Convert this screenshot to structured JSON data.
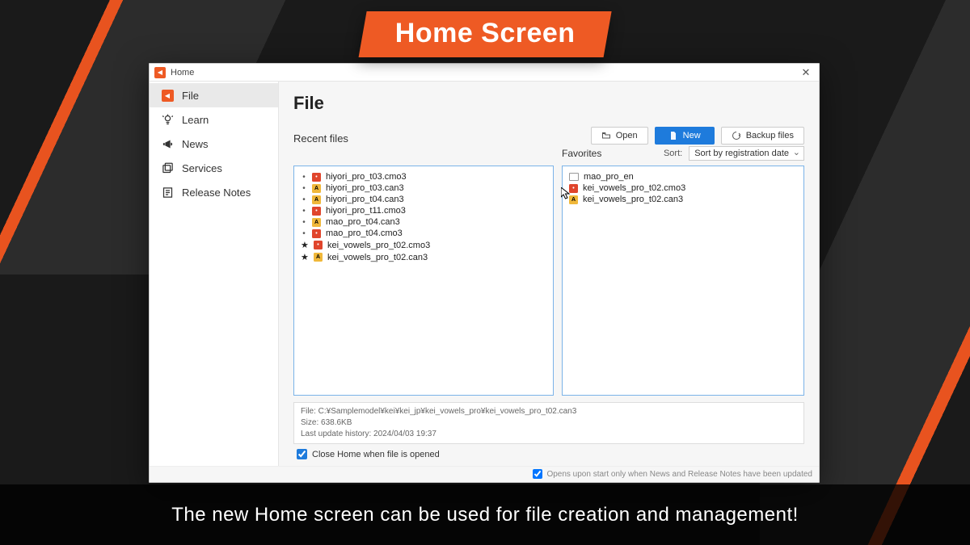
{
  "banner": {
    "title": "Home Screen"
  },
  "caption": "The new Home screen can be used for file creation and management!",
  "window": {
    "title": "Home",
    "sidebar": {
      "items": [
        {
          "label": "File",
          "icon": "file-icon",
          "active": true
        },
        {
          "label": "Learn",
          "icon": "lightbulb-icon",
          "active": false
        },
        {
          "label": "News",
          "icon": "megaphone-icon",
          "active": false
        },
        {
          "label": "Services",
          "icon": "services-icon",
          "active": false
        },
        {
          "label": "Release Notes",
          "icon": "notes-icon",
          "active": false
        }
      ]
    },
    "main": {
      "heading": "File",
      "buttons": {
        "open": "Open",
        "new": "New",
        "backup": "Backup files"
      },
      "recent_title": "Recent files",
      "favorites_title": "Favorites",
      "sort_label": "Sort:",
      "sort_value": "Sort by registration date",
      "recent_files": [
        {
          "mark": "dot",
          "type": "red",
          "name": "hiyori_pro_t03.cmo3"
        },
        {
          "mark": "dot",
          "type": "yellow",
          "name": "hiyori_pro_t03.can3"
        },
        {
          "mark": "dot",
          "type": "yellow",
          "name": "hiyori_pro_t04.can3"
        },
        {
          "mark": "dot",
          "type": "red",
          "name": "hiyori_pro_t11.cmo3"
        },
        {
          "mark": "dot",
          "type": "yellow",
          "name": "mao_pro_t04.can3"
        },
        {
          "mark": "dot",
          "type": "red",
          "name": "mao_pro_t04.cmo3"
        },
        {
          "mark": "star",
          "type": "red",
          "name": "kei_vowels_pro_t02.cmo3"
        },
        {
          "mark": "star",
          "type": "yellow",
          "name": "kei_vowels_pro_t02.can3"
        }
      ],
      "favorites": [
        {
          "type": "folder",
          "name": "mao_pro_en"
        },
        {
          "type": "red",
          "name": "kei_vowels_pro_t02.cmo3"
        },
        {
          "type": "yellow",
          "name": "kei_vowels_pro_t02.can3"
        }
      ],
      "info": {
        "path": "File: C:¥Samplemodel¥kei¥kei_jp¥kei_vowels_pro¥kei_vowels_pro_t02.can3",
        "size": "Size: 638.6KB",
        "updated": "Last update history: 2024/04/03 19:37"
      },
      "close_home_label": "Close Home when file is opened",
      "bottom_check_label": "Opens upon start only when News and Release Notes have been updated"
    }
  }
}
